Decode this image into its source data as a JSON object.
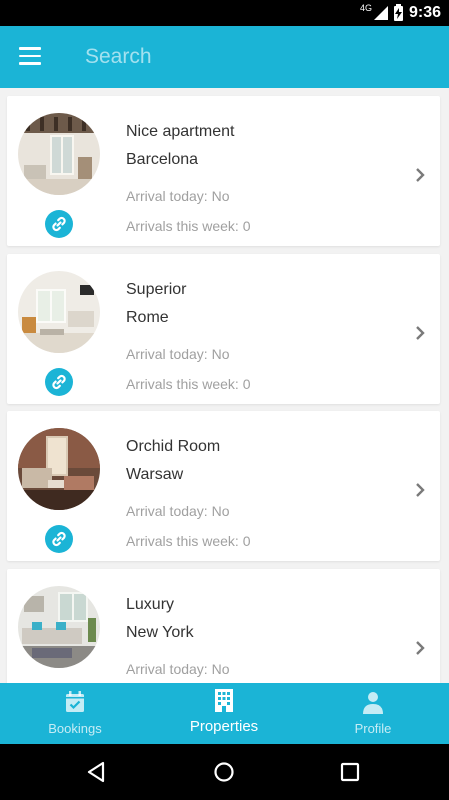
{
  "status_bar": {
    "network": "4G",
    "time": "9:36"
  },
  "app_bar": {
    "search_placeholder": "Search"
  },
  "properties": [
    {
      "title": "Nice apartment",
      "city": "Barcelona",
      "arrival_today": "Arrival today: No",
      "arrivals_week": "Arrivals this week: 0"
    },
    {
      "title": "Superior",
      "city": "Rome",
      "arrival_today": "Arrival today: No",
      "arrivals_week": "Arrivals this week: 0"
    },
    {
      "title": "Orchid Room",
      "city": "Warsaw",
      "arrival_today": "Arrival today: No",
      "arrivals_week": "Arrivals this week: 0"
    },
    {
      "title": "Luxury",
      "city": "New York",
      "arrival_today": "Arrival today: No",
      "arrivals_week": ""
    }
  ],
  "bottom_nav": {
    "items": [
      {
        "label": "Bookings",
        "icon": "calendar-check-icon",
        "active": false
      },
      {
        "label": "Properties",
        "icon": "building-icon",
        "active": true
      },
      {
        "label": "Profile",
        "icon": "person-icon",
        "active": false
      }
    ]
  },
  "colors": {
    "primary": "#1bb4d6",
    "text": "#333333",
    "muted": "#a0a0a0",
    "background": "#f2f2f2"
  }
}
